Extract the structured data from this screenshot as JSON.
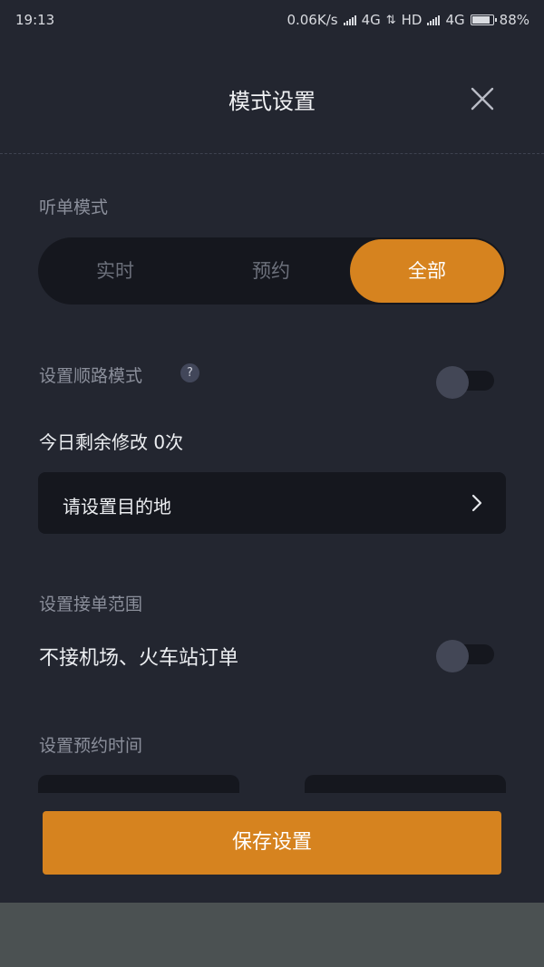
{
  "status_bar": {
    "time": "19:13",
    "net_speed": "0.06K/s",
    "network1": "4G",
    "hd": "HD",
    "network2": "4G",
    "battery": "88%",
    "battery_level": 0.88
  },
  "header": {
    "title": "模式设置",
    "close_icon": "close-icon"
  },
  "listen_mode": {
    "label": "听单模式",
    "options": [
      "实时",
      "预约",
      "全部"
    ],
    "selected": "全部"
  },
  "route_mode": {
    "label": "设置顺路模式",
    "help_glyph": "?",
    "enabled": false,
    "remaining_text": "今日剩余修改 0次",
    "destination_placeholder": "请设置目的地"
  },
  "order_range": {
    "label": "设置接单范围",
    "exclude_text": "不接机场、火车站订单",
    "enabled": false
  },
  "reservation_time": {
    "label": "设置预约时间"
  },
  "save_button": {
    "label": "保存设置"
  },
  "colors": {
    "background": "#232630",
    "accent": "#d6831f",
    "panel": "#15171e"
  }
}
